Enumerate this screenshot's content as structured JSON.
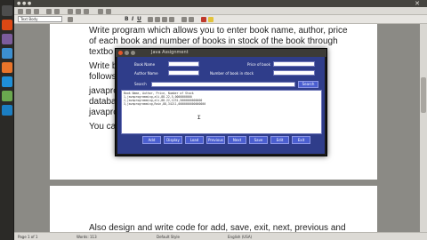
{
  "toolbar": {
    "paragraph_style": "Text Body"
  },
  "document": {
    "lines": [
      "Write program which allows you to enter book name, author, price",
      "of each book and number of books in stock of the book through",
      "textbo",
      "Write b",
      "follows",
      "javapro",
      "databa",
      "javapro",
      "You ca"
    ],
    "page2_lines": [
      "Also design and write code for add, save, exit, next, previous and"
    ]
  },
  "statusbar": {
    "page": "Page 1 of 1",
    "words": "Words: 113",
    "style": "Default Style",
    "lang": "English (USA)"
  },
  "dialog": {
    "title": "Java Assignment",
    "book_name_label": "Book Name",
    "price_label": "Price of book",
    "author_label": "Author Name",
    "stock_label": "Number of book in stock",
    "search_label": "Search",
    "search_button": "Search",
    "textarea_lines": [
      "Book Name, Author, Price, Number of Stock",
      "1,javaprogramming,ali,88.22,5,0000000000",
      "2,javaprogramming,ali,88.22,1231,5000000000000",
      "3,javaprogramming,Rain,88,34211,0000000000000000"
    ],
    "buttons": [
      "Add",
      "Display",
      "Load",
      "Previous",
      "Next",
      "Save",
      "Edit",
      "Exit"
    ]
  },
  "colors": {
    "dialog_body": "#2f3d8a",
    "button": "#4a5ed0"
  }
}
